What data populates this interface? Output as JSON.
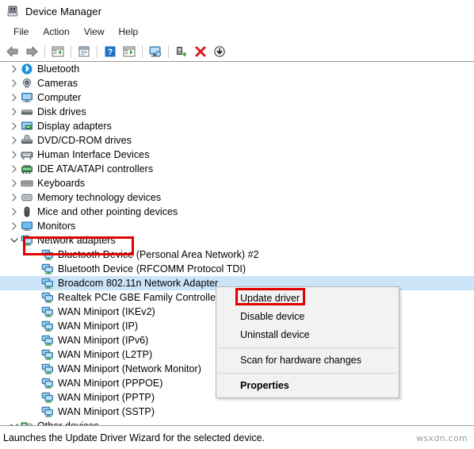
{
  "window": {
    "title": "Device Manager",
    "icon": "device-manager-icon"
  },
  "menubar": {
    "items": [
      {
        "label": "File",
        "name": "menu-file"
      },
      {
        "label": "Action",
        "name": "menu-action"
      },
      {
        "label": "View",
        "name": "menu-view"
      },
      {
        "label": "Help",
        "name": "menu-help"
      }
    ]
  },
  "toolbar": {
    "buttons": [
      {
        "icon": "back-arrow-icon"
      },
      {
        "icon": "forward-arrow-icon"
      },
      {
        "icon": "show-hide-console-tree-icon"
      },
      {
        "icon": "properties-icon"
      },
      {
        "icon": "help-icon"
      },
      {
        "icon": "show-hide-action-pane-icon"
      },
      {
        "icon": "scan-for-hardware-changes-icon"
      },
      {
        "icon": "update-driver-icon"
      },
      {
        "icon": "uninstall-device-icon"
      },
      {
        "icon": "disable-device-icon"
      }
    ]
  },
  "tree": {
    "items": [
      {
        "label": "Bluetooth",
        "level": 0,
        "twisty": "collapsed",
        "icon": "bluetooth-icon",
        "selected": false
      },
      {
        "label": "Cameras",
        "level": 0,
        "twisty": "collapsed",
        "icon": "camera-icon",
        "selected": false
      },
      {
        "label": "Computer",
        "level": 0,
        "twisty": "collapsed",
        "icon": "computer-icon",
        "selected": false
      },
      {
        "label": "Disk drives",
        "level": 0,
        "twisty": "collapsed",
        "icon": "disk-drive-icon",
        "selected": false
      },
      {
        "label": "Display adapters",
        "level": 0,
        "twisty": "collapsed",
        "icon": "display-adapter-icon",
        "selected": false
      },
      {
        "label": "DVD/CD-ROM drives",
        "level": 0,
        "twisty": "collapsed",
        "icon": "dvd-drive-icon",
        "selected": false
      },
      {
        "label": "Human Interface Devices",
        "level": 0,
        "twisty": "collapsed",
        "icon": "hid-icon",
        "selected": false
      },
      {
        "label": "IDE ATA/ATAPI controllers",
        "level": 0,
        "twisty": "collapsed",
        "icon": "ide-controller-icon",
        "selected": false
      },
      {
        "label": "Keyboards",
        "level": 0,
        "twisty": "collapsed",
        "icon": "keyboard-icon",
        "selected": false
      },
      {
        "label": "Memory technology devices",
        "level": 0,
        "twisty": "collapsed",
        "icon": "memory-device-icon",
        "selected": false
      },
      {
        "label": "Mice and other pointing devices",
        "level": 0,
        "twisty": "collapsed",
        "icon": "mouse-icon",
        "selected": false
      },
      {
        "label": "Monitors",
        "level": 0,
        "twisty": "collapsed",
        "icon": "monitor-icon",
        "selected": false
      },
      {
        "label": "Network adapters",
        "level": 0,
        "twisty": "expanded",
        "icon": "network-adapter-icon",
        "selected": false
      },
      {
        "label": "Bluetooth Device (Personal Area Network) #2",
        "level": 1,
        "twisty": "none",
        "icon": "network-adapter-icon",
        "selected": false
      },
      {
        "label": "Bluetooth Device (RFCOMM Protocol TDI)",
        "level": 1,
        "twisty": "none",
        "icon": "network-adapter-icon",
        "selected": false
      },
      {
        "label": "Broadcom 802.11n Network Adapter",
        "level": 1,
        "twisty": "none",
        "icon": "network-adapter-icon",
        "selected": true
      },
      {
        "label": "Realtek PCIe GBE Family Controller",
        "level": 1,
        "twisty": "none",
        "icon": "network-adapter-icon",
        "selected": false
      },
      {
        "label": "WAN Miniport (IKEv2)",
        "level": 1,
        "twisty": "none",
        "icon": "network-adapter-icon",
        "selected": false
      },
      {
        "label": "WAN Miniport (IP)",
        "level": 1,
        "twisty": "none",
        "icon": "network-adapter-icon",
        "selected": false
      },
      {
        "label": "WAN Miniport (IPv6)",
        "level": 1,
        "twisty": "none",
        "icon": "network-adapter-icon",
        "selected": false
      },
      {
        "label": "WAN Miniport (L2TP)",
        "level": 1,
        "twisty": "none",
        "icon": "network-adapter-icon",
        "selected": false
      },
      {
        "label": "WAN Miniport (Network Monitor)",
        "level": 1,
        "twisty": "none",
        "icon": "network-adapter-icon",
        "selected": false
      },
      {
        "label": "WAN Miniport (PPPOE)",
        "level": 1,
        "twisty": "none",
        "icon": "network-adapter-icon",
        "selected": false
      },
      {
        "label": "WAN Miniport (PPTP)",
        "level": 1,
        "twisty": "none",
        "icon": "network-adapter-icon",
        "selected": false
      },
      {
        "label": "WAN Miniport (SSTP)",
        "level": 1,
        "twisty": "none",
        "icon": "network-adapter-icon",
        "selected": false
      },
      {
        "label": "Other devices",
        "level": 0,
        "twisty": "expanded",
        "icon": "other-devices-warning-icon",
        "selected": false
      }
    ]
  },
  "context_menu": {
    "items": [
      {
        "label": "Update driver",
        "name": "ctx-update-driver",
        "bold": false,
        "separator_after": false
      },
      {
        "label": "Disable device",
        "name": "ctx-disable-device",
        "bold": false,
        "separator_after": false
      },
      {
        "label": "Uninstall device",
        "name": "ctx-uninstall-device",
        "bold": false,
        "separator_after": true
      },
      {
        "label": "Scan for hardware changes",
        "name": "ctx-scan-hardware",
        "bold": false,
        "separator_after": true
      },
      {
        "label": "Properties",
        "name": "ctx-properties",
        "bold": true,
        "separator_after": false
      }
    ]
  },
  "statusbar": {
    "text": "Launches the Update Driver Wizard for the selected device."
  },
  "watermark": {
    "text": "wsxdn.com"
  },
  "annotations": {
    "highlight_color": "#e00000",
    "boxes": [
      {
        "name": "redbox-network-adapters",
        "target": "Network adapters"
      },
      {
        "name": "redbox-update-driver",
        "target": "Update driver"
      }
    ]
  }
}
